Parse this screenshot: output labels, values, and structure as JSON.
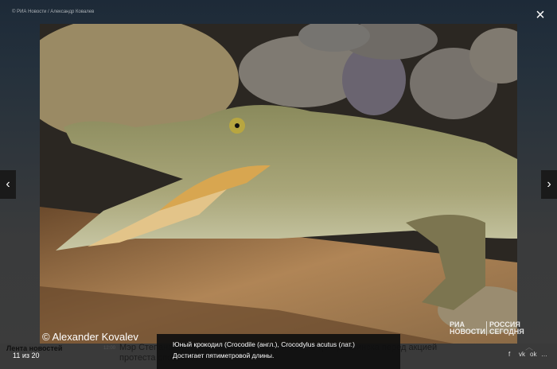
{
  "top_credit": "© РИА Новости / Александр Ковалев",
  "photo_credit": "© Alexander Kovalev",
  "watermark": {
    "ria_line1": "РИА",
    "ria_line2": "НОВОСТИ",
    "rs_line1": "РОССИЯ",
    "rs_line2": "СЕГОДНЯ"
  },
  "caption": {
    "line1": "Юный крокодил (Crocodile (англ.), Crocodylus acutus (лат.)",
    "line2": "Достигает пятиметровой длины."
  },
  "feed": {
    "title": "Лента новостей",
    "count": "11 из 20"
  },
  "news": {
    "time": "12:00",
    "text": "Мэр Степанакерта рассказал о ситуации со … в центре Минска перед акцией протеста спокойная"
  },
  "icons": {
    "close": "×",
    "prev": "‹",
    "next": "›",
    "facebook": "f",
    "vk": "vk",
    "ok": "ok",
    "more": "…"
  }
}
